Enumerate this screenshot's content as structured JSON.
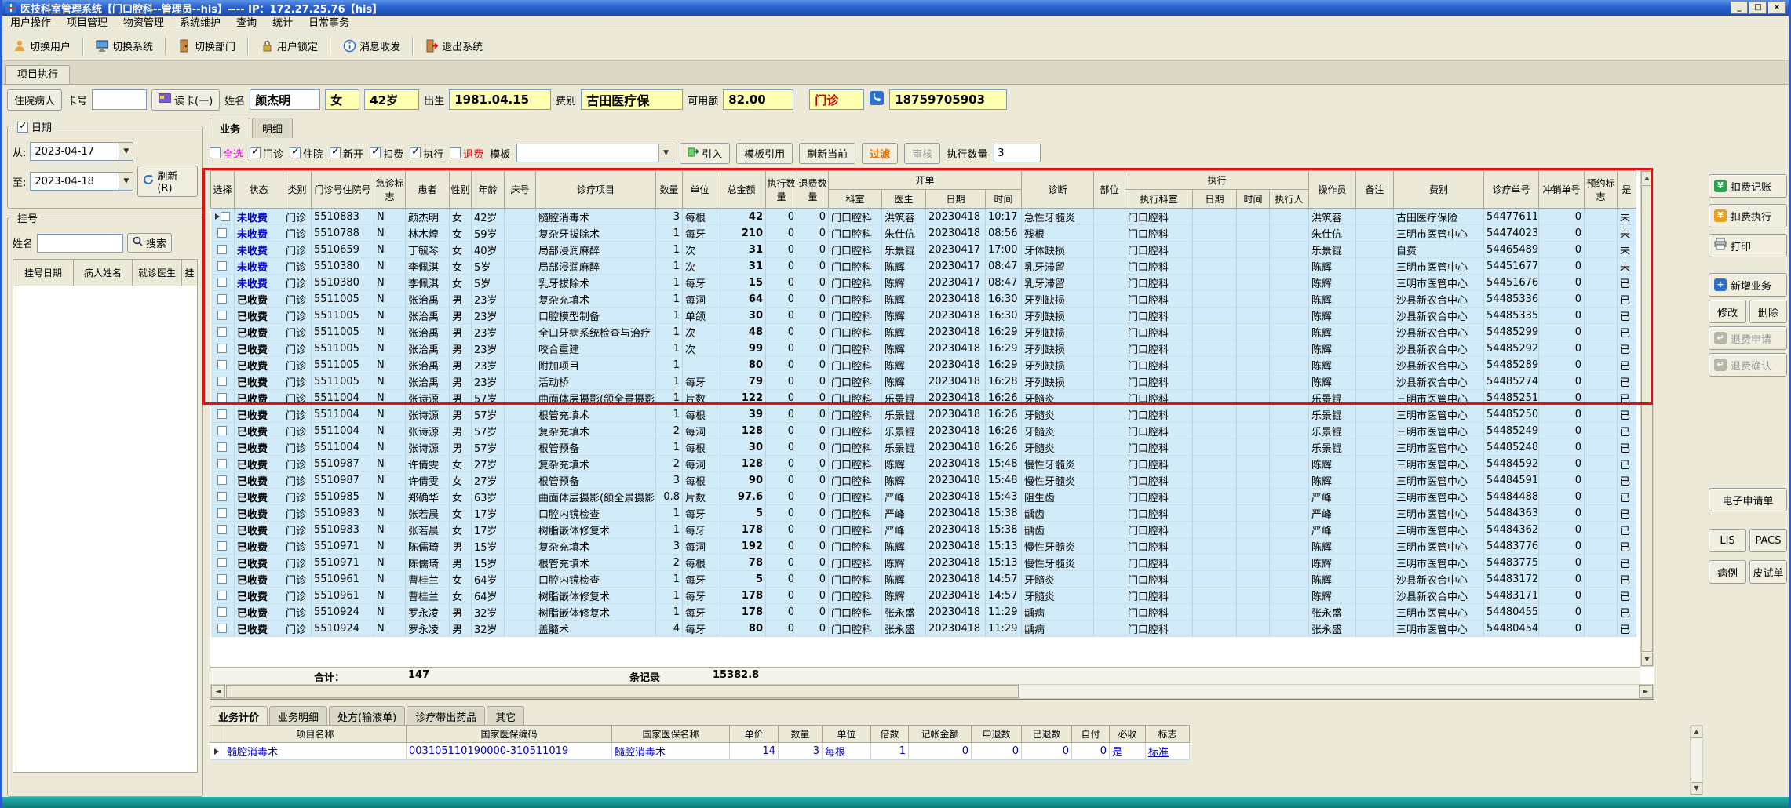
{
  "window": {
    "title": "医技科室管理系统【门口腔科--管理员--his】---- IP：172.27.25.76【his】"
  },
  "menu": {
    "items": [
      "用户操作",
      "项目管理",
      "物资管理",
      "系统维护",
      "查询",
      "统计",
      "日常事务"
    ]
  },
  "toolbar": {
    "items": [
      "切换用户",
      "切换系统",
      "切换部门",
      "用户锁定",
      "消息收发",
      "退出系统"
    ]
  },
  "page_tab": "项目执行",
  "patient": {
    "inpatient": "住院病人",
    "card_label": "卡号",
    "card_value": "",
    "read_card": "读卡(一)",
    "name_label": "姓名",
    "name": "颜杰明",
    "gender": "女",
    "age": "42岁",
    "birth_label": "出生",
    "birth": "1981.04.15",
    "fee_label": "费别",
    "fee": "古田医疗保",
    "avail_label": "可用额",
    "avail": "82.00",
    "visit": "门诊",
    "phone": "18759705903"
  },
  "left": {
    "date_group": "日期",
    "from_label": "从:",
    "from_value": "2023-04-17",
    "to_label": "至:",
    "to_value": "2023-04-18",
    "refresh": "刷新(R)",
    "reg_group": "挂号",
    "name_label": "姓名",
    "name_value": "",
    "search": "搜索",
    "headers": [
      "挂号日期",
      "病人姓名",
      "就诊医生",
      "挂"
    ]
  },
  "main": {
    "tabs": [
      "业务",
      "明细"
    ],
    "filter": {
      "select_all": "全选",
      "cb_outpatient": "门诊",
      "cb_inpatient": "住院",
      "cb_new": "新开",
      "cb_deduct": "扣费",
      "cb_exec": "执行",
      "cb_refund": "退费",
      "template_label": "模板",
      "template_value": "",
      "btn_import": "引入",
      "btn_template_ref": "模板引用",
      "btn_refresh_current": "刷新当前",
      "btn_filter": "过滤",
      "btn_audit": "审核",
      "exec_qty_label": "执行数量",
      "exec_qty": "3"
    },
    "grid": {
      "headers": {
        "sel": "选择",
        "status": "状态",
        "type": "类别",
        "visit_no": "门诊号住院号",
        "emergency": "急诊标志",
        "patient": "患者",
        "gender": "性别",
        "age": "年龄",
        "bed": "床号",
        "item": "诊疗项目",
        "qty": "数量",
        "unit": "单位",
        "amount": "总金额",
        "exec_qty": "执行数量",
        "refund_qty": "退费数量",
        "order_group": "开单",
        "order_dept": "科室",
        "order_doctor": "医生",
        "order_date": "日期",
        "order_time": "时间",
        "diagnosis": "诊断",
        "part": "部位",
        "exec_group": "执行",
        "exec_dept": "执行科室",
        "exec_date": "日期",
        "exec_time": "时间",
        "exec_person": "执行人",
        "operator": "操作员",
        "remark": "备注",
        "fee_type": "费别",
        "order_no": "诊疗单号",
        "reverse_no": "冲销单号",
        "appointment": "预约标志",
        "charged": "是"
      },
      "rows": [
        [
          "未收费",
          "门诊",
          "5510883",
          "N",
          "颜杰明",
          "女",
          "42岁",
          "",
          "髓腔消毒术",
          "3",
          "每根",
          "42",
          "0",
          "0",
          "门口腔科",
          "洪筑容",
          "20230418",
          "10:17",
          "急性牙髓炎",
          "",
          "门口腔科",
          "",
          "",
          "",
          "洪筑容",
          "",
          "古田医疗保险",
          "54477611",
          "0",
          "",
          "未"
        ],
        [
          "未收费",
          "门诊",
          "5510788",
          "N",
          "林木煌",
          "女",
          "59岁",
          "",
          "复杂牙拔除术",
          "1",
          "每牙",
          "210",
          "0",
          "0",
          "门口腔科",
          "朱仕伉",
          "20230418",
          "08:56",
          "残根",
          "",
          "门口腔科",
          "",
          "",
          "",
          "朱仕伉",
          "",
          "三明市医管中心",
          "54474023",
          "0",
          "",
          "未"
        ],
        [
          "未收费",
          "门诊",
          "5510659",
          "N",
          "丁毓琴",
          "女",
          "40岁",
          "",
          "局部浸润麻醉",
          "1",
          "次",
          "31",
          "0",
          "0",
          "门口腔科",
          "乐景锟",
          "20230417",
          "17:00",
          "牙体缺损",
          "",
          "门口腔科",
          "",
          "",
          "",
          "乐景锟",
          "",
          "自费",
          "54465489",
          "0",
          "",
          "未"
        ],
        [
          "未收费",
          "门诊",
          "5510380",
          "N",
          "李佩淇",
          "女",
          "5岁",
          "",
          "局部浸润麻醉",
          "1",
          "次",
          "31",
          "0",
          "0",
          "门口腔科",
          "陈辉",
          "20230417",
          "08:47",
          "乳牙滞留",
          "",
          "门口腔科",
          "",
          "",
          "",
          "陈辉",
          "",
          "三明市医管中心",
          "54451677",
          "0",
          "",
          "未"
        ],
        [
          "未收费",
          "门诊",
          "5510380",
          "N",
          "李佩淇",
          "女",
          "5岁",
          "",
          "乳牙拔除术",
          "1",
          "每牙",
          "15",
          "0",
          "0",
          "门口腔科",
          "陈辉",
          "20230417",
          "08:47",
          "乳牙滞留",
          "",
          "门口腔科",
          "",
          "",
          "",
          "陈辉",
          "",
          "三明市医管中心",
          "54451676",
          "0",
          "",
          "已"
        ],
        [
          "已收费",
          "门诊",
          "5511005",
          "N",
          "张治禹",
          "男",
          "23岁",
          "",
          "复杂充填术",
          "1",
          "每洞",
          "64",
          "0",
          "0",
          "门口腔科",
          "陈辉",
          "20230418",
          "16:30",
          "牙列缺损",
          "",
          "门口腔科",
          "",
          "",
          "",
          "陈辉",
          "",
          "沙县新农合中心",
          "54485336",
          "0",
          "",
          "已"
        ],
        [
          "已收费",
          "门诊",
          "5511005",
          "N",
          "张治禹",
          "男",
          "23岁",
          "",
          "口腔模型制备",
          "1",
          "单颌",
          "30",
          "0",
          "0",
          "门口腔科",
          "陈辉",
          "20230418",
          "16:30",
          "牙列缺损",
          "",
          "门口腔科",
          "",
          "",
          "",
          "陈辉",
          "",
          "沙县新农合中心",
          "54485335",
          "0",
          "",
          "已"
        ],
        [
          "已收费",
          "门诊",
          "5511005",
          "N",
          "张治禹",
          "男",
          "23岁",
          "",
          "全口牙病系统检查与治疗",
          "1",
          "次",
          "48",
          "0",
          "0",
          "门口腔科",
          "陈辉",
          "20230418",
          "16:29",
          "牙列缺损",
          "",
          "门口腔科",
          "",
          "",
          "",
          "陈辉",
          "",
          "沙县新农合中心",
          "54485299",
          "0",
          "",
          "已"
        ],
        [
          "已收费",
          "门诊",
          "5511005",
          "N",
          "张治禹",
          "男",
          "23岁",
          "",
          "咬合重建",
          "1",
          "次",
          "99",
          "0",
          "0",
          "门口腔科",
          "陈辉",
          "20230418",
          "16:29",
          "牙列缺损",
          "",
          "门口腔科",
          "",
          "",
          "",
          "陈辉",
          "",
          "沙县新农合中心",
          "54485292",
          "0",
          "",
          "已"
        ],
        [
          "已收费",
          "门诊",
          "5511005",
          "N",
          "张治禹",
          "男",
          "23岁",
          "",
          "附加项目",
          "1",
          "",
          "80",
          "0",
          "0",
          "门口腔科",
          "陈辉",
          "20230418",
          "16:29",
          "牙列缺损",
          "",
          "门口腔科",
          "",
          "",
          "",
          "陈辉",
          "",
          "沙县新农合中心",
          "54485289",
          "0",
          "",
          "已"
        ],
        [
          "已收费",
          "门诊",
          "5511005",
          "N",
          "张治禹",
          "男",
          "23岁",
          "",
          "活动桥",
          "1",
          "每牙",
          "79",
          "0",
          "0",
          "门口腔科",
          "陈辉",
          "20230418",
          "16:28",
          "牙列缺损",
          "",
          "门口腔科",
          "",
          "",
          "",
          "陈辉",
          "",
          "沙县新农合中心",
          "54485274",
          "0",
          "",
          "已"
        ],
        [
          "已收费",
          "门诊",
          "5511004",
          "N",
          "张诗源",
          "男",
          "57岁",
          "",
          "曲面体层摄影(颌全景摄影)",
          "1",
          "片数",
          "122",
          "0",
          "0",
          "门口腔科",
          "乐景锟",
          "20230418",
          "16:26",
          "牙髓炎",
          "",
          "门口腔科",
          "",
          "",
          "",
          "乐景锟",
          "",
          "三明市医管中心",
          "54485251",
          "0",
          "",
          "已"
        ],
        [
          "已收费",
          "门诊",
          "5511004",
          "N",
          "张诗源",
          "男",
          "57岁",
          "",
          "根管充填术",
          "1",
          "每根",
          "39",
          "0",
          "0",
          "门口腔科",
          "乐景锟",
          "20230418",
          "16:26",
          "牙髓炎",
          "",
          "门口腔科",
          "",
          "",
          "",
          "乐景锟",
          "",
          "三明市医管中心",
          "54485250",
          "0",
          "",
          "已"
        ],
        [
          "已收费",
          "门诊",
          "5511004",
          "N",
          "张诗源",
          "男",
          "57岁",
          "",
          "复杂充填术",
          "2",
          "每洞",
          "128",
          "0",
          "0",
          "门口腔科",
          "乐景锟",
          "20230418",
          "16:26",
          "牙髓炎",
          "",
          "门口腔科",
          "",
          "",
          "",
          "乐景锟",
          "",
          "三明市医管中心",
          "54485249",
          "0",
          "",
          "已"
        ],
        [
          "已收费",
          "门诊",
          "5511004",
          "N",
          "张诗源",
          "男",
          "57岁",
          "",
          "根管预备",
          "1",
          "每根",
          "30",
          "0",
          "0",
          "门口腔科",
          "乐景锟",
          "20230418",
          "16:26",
          "牙髓炎",
          "",
          "门口腔科",
          "",
          "",
          "",
          "乐景锟",
          "",
          "三明市医管中心",
          "54485248",
          "0",
          "",
          "已"
        ],
        [
          "已收费",
          "门诊",
          "5510987",
          "N",
          "许倩雯",
          "女",
          "27岁",
          "",
          "复杂充填术",
          "2",
          "每洞",
          "128",
          "0",
          "0",
          "门口腔科",
          "陈辉",
          "20230418",
          "15:48",
          "慢性牙髓炎",
          "",
          "门口腔科",
          "",
          "",
          "",
          "陈辉",
          "",
          "三明市医管中心",
          "54484592",
          "0",
          "",
          "已"
        ],
        [
          "已收费",
          "门诊",
          "5510987",
          "N",
          "许倩雯",
          "女",
          "27岁",
          "",
          "根管预备",
          "3",
          "每根",
          "90",
          "0",
          "0",
          "门口腔科",
          "陈辉",
          "20230418",
          "15:48",
          "慢性牙髓炎",
          "",
          "门口腔科",
          "",
          "",
          "",
          "陈辉",
          "",
          "三明市医管中心",
          "54484591",
          "0",
          "",
          "已"
        ],
        [
          "已收费",
          "门诊",
          "5510985",
          "N",
          "郑确华",
          "女",
          "63岁",
          "",
          "曲面体层摄影(颌全景摄影)",
          "0.8",
          "片数",
          "97.6",
          "0",
          "0",
          "门口腔科",
          "严峰",
          "20230418",
          "15:43",
          "阻生齿",
          "",
          "门口腔科",
          "",
          "",
          "",
          "严峰",
          "",
          "三明市医管中心",
          "54484488",
          "0",
          "",
          "已"
        ],
        [
          "已收费",
          "门诊",
          "5510983",
          "N",
          "张若晨",
          "女",
          "17岁",
          "",
          "口腔内镜检查",
          "1",
          "每牙",
          "5",
          "0",
          "0",
          "门口腔科",
          "严峰",
          "20230418",
          "15:38",
          "龋齿",
          "",
          "门口腔科",
          "",
          "",
          "",
          "严峰",
          "",
          "三明市医管中心",
          "54484363",
          "0",
          "",
          "已"
        ],
        [
          "已收费",
          "门诊",
          "5510983",
          "N",
          "张若晨",
          "女",
          "17岁",
          "",
          "树脂嵌体修复术",
          "1",
          "每牙",
          "178",
          "0",
          "0",
          "门口腔科",
          "严峰",
          "20230418",
          "15:38",
          "龋齿",
          "",
          "门口腔科",
          "",
          "",
          "",
          "严峰",
          "",
          "三明市医管中心",
          "54484362",
          "0",
          "",
          "已"
        ],
        [
          "已收费",
          "门诊",
          "5510971",
          "N",
          "陈儒琦",
          "男",
          "15岁",
          "",
          "复杂充填术",
          "3",
          "每洞",
          "192",
          "0",
          "0",
          "门口腔科",
          "陈辉",
          "20230418",
          "15:13",
          "慢性牙髓炎",
          "",
          "门口腔科",
          "",
          "",
          "",
          "陈辉",
          "",
          "三明市医管中心",
          "54483776",
          "0",
          "",
          "已"
        ],
        [
          "已收费",
          "门诊",
          "5510971",
          "N",
          "陈儒琦",
          "男",
          "15岁",
          "",
          "根管充填术",
          "2",
          "每根",
          "78",
          "0",
          "0",
          "门口腔科",
          "陈辉",
          "20230418",
          "15:13",
          "慢性牙髓炎",
          "",
          "门口腔科",
          "",
          "",
          "",
          "陈辉",
          "",
          "三明市医管中心",
          "54483775",
          "0",
          "",
          "已"
        ],
        [
          "已收费",
          "门诊",
          "5510961",
          "N",
          "曹桂兰",
          "女",
          "64岁",
          "",
          "口腔内镜检查",
          "1",
          "每牙",
          "5",
          "0",
          "0",
          "门口腔科",
          "陈辉",
          "20230418",
          "14:57",
          "牙髓炎",
          "",
          "门口腔科",
          "",
          "",
          "",
          "陈辉",
          "",
          "沙县新农合中心",
          "54483172",
          "0",
          "",
          "已"
        ],
        [
          "已收费",
          "门诊",
          "5510961",
          "N",
          "曹桂兰",
          "女",
          "64岁",
          "",
          "树脂嵌体修复术",
          "1",
          "每牙",
          "178",
          "0",
          "0",
          "门口腔科",
          "陈辉",
          "20230418",
          "14:57",
          "牙髓炎",
          "",
          "门口腔科",
          "",
          "",
          "",
          "陈辉",
          "",
          "沙县新农合中心",
          "54483171",
          "0",
          "",
          "已"
        ],
        [
          "已收费",
          "门诊",
          "5510924",
          "N",
          "罗永凌",
          "男",
          "32岁",
          "",
          "树脂嵌体修复术",
          "1",
          "每牙",
          "178",
          "0",
          "0",
          "门口腔科",
          "张永盛",
          "20230418",
          "11:29",
          "龋病",
          "",
          "门口腔科",
          "",
          "",
          "",
          "张永盛",
          "",
          "三明市医管中心",
          "54480455",
          "0",
          "",
          "已"
        ],
        [
          "已收费",
          "门诊",
          "5510924",
          "N",
          "罗永凌",
          "男",
          "32岁",
          "",
          "盖髓术",
          "4",
          "每牙",
          "80",
          "0",
          "0",
          "门口腔科",
          "张永盛",
          "20230418",
          "11:29",
          "龋病",
          "",
          "门口腔科",
          "",
          "",
          "",
          "张永盛",
          "",
          "三明市医管中心",
          "54480454",
          "0",
          "",
          "已"
        ]
      ],
      "summary": {
        "label": "合计：",
        "count": "147",
        "records": "条记录",
        "amount": "15382.8"
      }
    },
    "bottom": {
      "tabs": [
        "业务计价",
        "业务明细",
        "处方(输液单)",
        "诊疗带出药品",
        "其它"
      ],
      "headers": [
        "项目名称",
        "国家医保编码",
        "国家医保名称",
        "单价",
        "数量",
        "单位",
        "倍数",
        "记帐金额",
        "申退数",
        "已退数",
        "自付",
        "必收",
        "标志"
      ],
      "rows": [
        [
          "髓腔消毒术",
          "003105110190000-310511019",
          "髓腔消毒术",
          "14",
          "3",
          "每根",
          "1",
          "0",
          "0",
          "0",
          "0",
          "是",
          "标准"
        ]
      ]
    }
  },
  "right": {
    "deduct_account": "扣费记账",
    "deduct_exec": "扣费执行",
    "print": "打印",
    "new_business": "新增业务",
    "modify": "修改",
    "delete": "删除",
    "refund_request": "退费申请",
    "refund_confirm": "退费确认",
    "e_request": "电子申请单",
    "lis": "LIS",
    "pacs": "PACS",
    "case": "病例",
    "skin_test": "皮试单"
  }
}
